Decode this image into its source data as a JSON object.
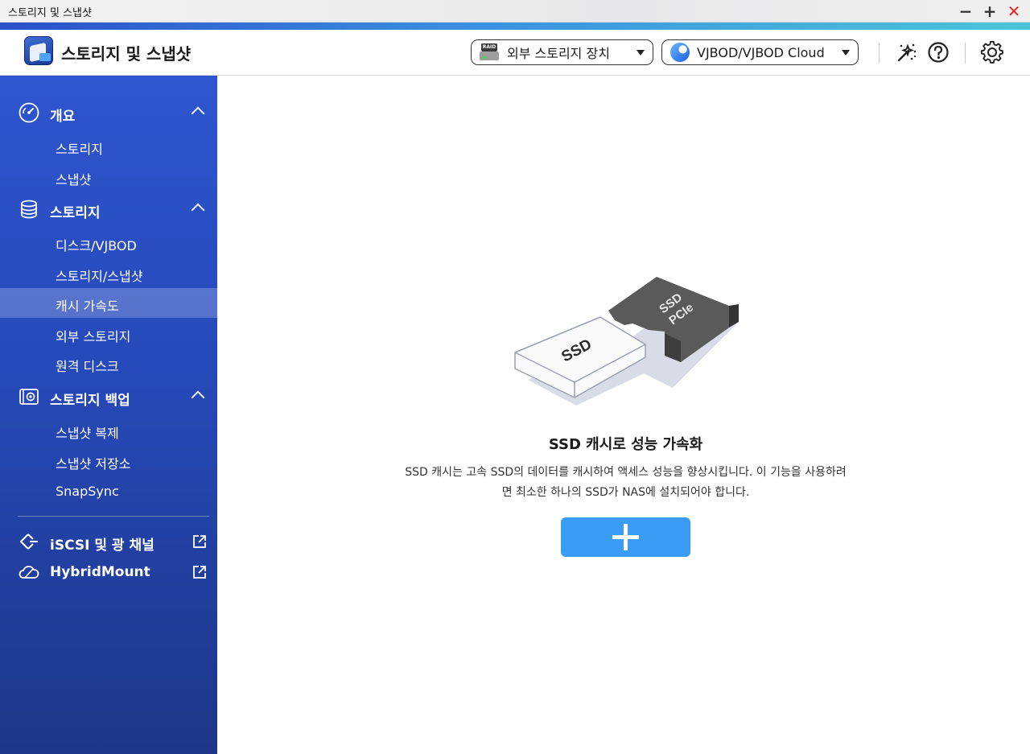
{
  "window": {
    "title": "스토리지 및 스냅샷"
  },
  "header": {
    "app_title": "스토리지 및 스냅샷",
    "external_storage_dropdown": {
      "label": "외부 스토리지 장치",
      "icon": "raid-device-icon",
      "icon_text": "RAID"
    },
    "vjbod_dropdown": {
      "label": "VJBOD/VJBOD Cloud",
      "icon": "vjbod-cloud-icon"
    },
    "icons": [
      "magic-wand-icon",
      "help-icon",
      "settings-gear-icon"
    ]
  },
  "sidebar": {
    "groups": [
      {
        "label": "개요",
        "icon": "dashboard-gauge-icon",
        "items": [
          "스토리지",
          "스냅샷"
        ]
      },
      {
        "label": "스토리지",
        "icon": "database-icon",
        "items": [
          "디스크/VJBOD",
          "스토리지/스냅샷",
          "캐시 가속도",
          "외부 스토리지",
          "원격 디스크"
        ]
      },
      {
        "label": "스토리지 백업",
        "icon": "backup-camera-icon",
        "items": [
          "스냅샷 복제",
          "스냅샷 저장소",
          "SnapSync"
        ]
      }
    ],
    "external_links": [
      {
        "label": "iSCSI 및 광 채널",
        "icon": "iscsi-icon"
      },
      {
        "label": "HybridMount",
        "icon": "hybridmount-cloud-icon"
      }
    ],
    "active_item": "캐시 가속도"
  },
  "main": {
    "illustration": {
      "ssd_label": "SSD",
      "pcie_label_1": "SSD",
      "pcie_label_2": "PCIe"
    },
    "title": "SSD 캐시로 성능 가속화",
    "description_line1": "SSD 캐시는 고속 SSD의 데이터를 캐시하여 액세스 성능을 향상시킵니다. 이 기능을 사용하려",
    "description_line2": "면 최소한 하나의 SSD가 NAS에 설치되어야 합니다.",
    "add_button_icon": "plus-icon"
  },
  "colors": {
    "accent": "#3a9cf5",
    "sidebar": "#2649b8",
    "close": "#e0262e"
  }
}
